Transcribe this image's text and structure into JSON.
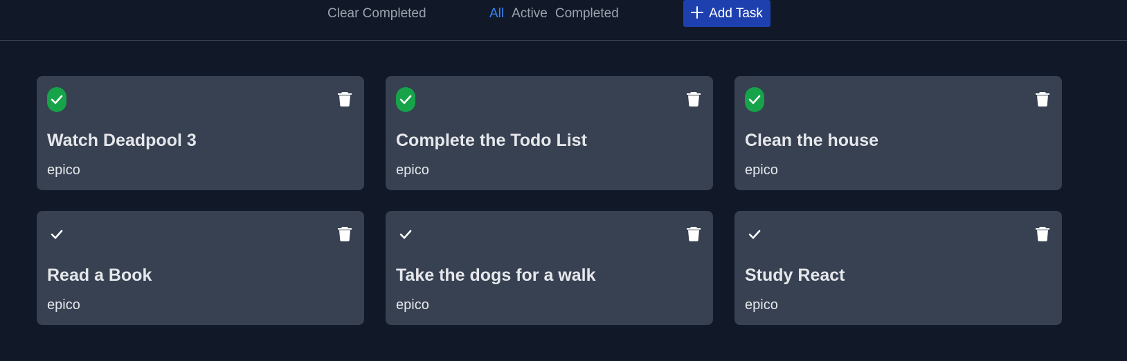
{
  "toolbar": {
    "clear_completed_label": "Clear Completed",
    "filters": [
      {
        "label": "All",
        "active": true
      },
      {
        "label": "Active",
        "active": false
      },
      {
        "label": "Completed",
        "active": false
      }
    ],
    "add_task_label": "Add Task",
    "add_task_icon": "plus-icon"
  },
  "colors": {
    "background": "#111827",
    "card": "#374151",
    "accent": "#3b82f6",
    "button": "#1e40af",
    "done": "#16a34a"
  },
  "tasks": [
    {
      "title": "Watch Deadpool 3",
      "description": "epico",
      "completed": true
    },
    {
      "title": "Complete the Todo List",
      "description": "epico",
      "completed": true
    },
    {
      "title": "Clean the house",
      "description": "epico",
      "completed": true
    },
    {
      "title": "Read a Book",
      "description": "epico",
      "completed": false
    },
    {
      "title": "Take the dogs for a walk",
      "description": "epico",
      "completed": false
    },
    {
      "title": "Study React",
      "description": "epico",
      "completed": false
    }
  ]
}
